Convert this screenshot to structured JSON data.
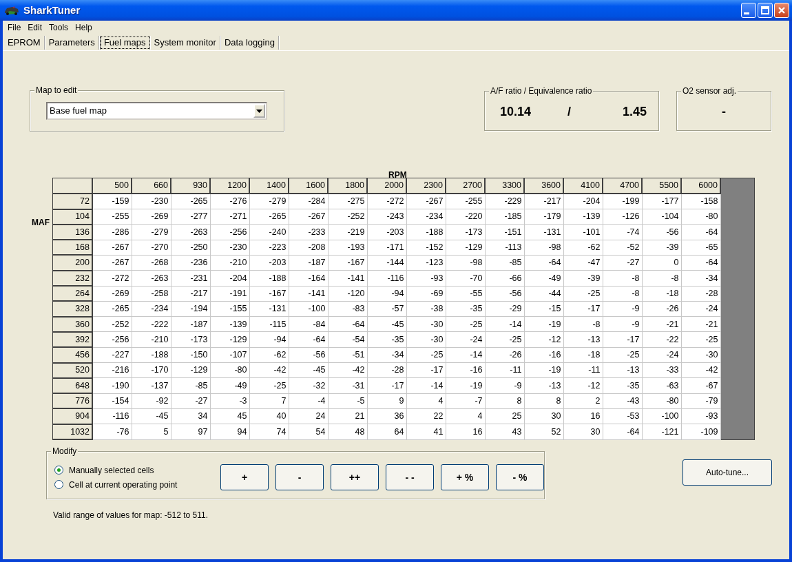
{
  "window": {
    "title": "SharkTuner"
  },
  "menu": [
    "File",
    "Edit",
    "Tools",
    "Help"
  ],
  "tabs": [
    {
      "label": "EPROM",
      "selected": false
    },
    {
      "label": "Parameters",
      "selected": false
    },
    {
      "label": "Fuel maps",
      "selected": true
    },
    {
      "label": "System monitor",
      "selected": false
    },
    {
      "label": "Data logging",
      "selected": false
    }
  ],
  "map_to_edit": {
    "label": "Map to edit",
    "value": "Base fuel map"
  },
  "af_ratio": {
    "label": "A/F ratio / Equivalence ratio",
    "af": "10.14",
    "separator": "/",
    "equivalence": "1.45"
  },
  "o2_sensor": {
    "label": "O2 sensor adj.",
    "value": "-"
  },
  "fuel_table": {
    "x_label": "RPM",
    "y_label": "MAF",
    "columns": [
      "500",
      "660",
      "930",
      "1200",
      "1400",
      "1600",
      "1800",
      "2000",
      "2300",
      "2700",
      "3300",
      "3600",
      "4100",
      "4700",
      "5500",
      "6000"
    ],
    "rows": [
      {
        "label": "72",
        "cells": [
          "-159",
          "-230",
          "-265",
          "-276",
          "-279",
          "-284",
          "-275",
          "-272",
          "-267",
          "-255",
          "-229",
          "-217",
          "-204",
          "-199",
          "-177",
          "-158"
        ]
      },
      {
        "label": "104",
        "cells": [
          "-255",
          "-269",
          "-277",
          "-271",
          "-265",
          "-267",
          "-252",
          "-243",
          "-234",
          "-220",
          "-185",
          "-179",
          "-139",
          "-126",
          "-104",
          "-80"
        ]
      },
      {
        "label": "136",
        "cells": [
          "-286",
          "-279",
          "-263",
          "-256",
          "-240",
          "-233",
          "-219",
          "-203",
          "-188",
          "-173",
          "-151",
          "-131",
          "-101",
          "-74",
          "-56",
          "-64"
        ]
      },
      {
        "label": "168",
        "cells": [
          "-267",
          "-270",
          "-250",
          "-230",
          "-223",
          "-208",
          "-193",
          "-171",
          "-152",
          "-129",
          "-113",
          "-98",
          "-62",
          "-52",
          "-39",
          "-65"
        ]
      },
      {
        "label": "200",
        "cells": [
          "-267",
          "-268",
          "-236",
          "-210",
          "-203",
          "-187",
          "-167",
          "-144",
          "-123",
          "-98",
          "-85",
          "-64",
          "-47",
          "-27",
          "0",
          "-64"
        ]
      },
      {
        "label": "232",
        "cells": [
          "-272",
          "-263",
          "-231",
          "-204",
          "-188",
          "-164",
          "-141",
          "-116",
          "-93",
          "-70",
          "-66",
          "-49",
          "-39",
          "-8",
          "-8",
          "-34"
        ]
      },
      {
        "label": "264",
        "cells": [
          "-269",
          "-258",
          "-217",
          "-191",
          "-167",
          "-141",
          "-120",
          "-94",
          "-69",
          "-55",
          "-56",
          "-44",
          "-25",
          "-8",
          "-18",
          "-28"
        ]
      },
      {
        "label": "328",
        "cells": [
          "-265",
          "-234",
          "-194",
          "-155",
          "-131",
          "-100",
          "-83",
          "-57",
          "-38",
          "-35",
          "-29",
          "-15",
          "-17",
          "-9",
          "-26",
          "-24"
        ]
      },
      {
        "label": "360",
        "cells": [
          "-252",
          "-222",
          "-187",
          "-139",
          "-115",
          "-84",
          "-64",
          "-45",
          "-30",
          "-25",
          "-14",
          "-19",
          "-8",
          "-9",
          "-21",
          "-21"
        ]
      },
      {
        "label": "392",
        "cells": [
          "-256",
          "-210",
          "-173",
          "-129",
          "-94",
          "-64",
          "-54",
          "-35",
          "-30",
          "-24",
          "-25",
          "-12",
          "-13",
          "-17",
          "-22",
          "-25"
        ]
      },
      {
        "label": "456",
        "cells": [
          "-227",
          "-188",
          "-150",
          "-107",
          "-62",
          "-56",
          "-51",
          "-34",
          "-25",
          "-14",
          "-26",
          "-16",
          "-18",
          "-25",
          "-24",
          "-30"
        ]
      },
      {
        "label": "520",
        "cells": [
          "-216",
          "-170",
          "-129",
          "-80",
          "-42",
          "-45",
          "-42",
          "-28",
          "-17",
          "-16",
          "-11",
          "-19",
          "-11",
          "-13",
          "-33",
          "-42"
        ]
      },
      {
        "label": "648",
        "cells": [
          "-190",
          "-137",
          "-85",
          "-49",
          "-25",
          "-32",
          "-31",
          "-17",
          "-14",
          "-19",
          "-9",
          "-13",
          "-12",
          "-35",
          "-63",
          "-67"
        ]
      },
      {
        "label": "776",
        "cells": [
          "-154",
          "-92",
          "-27",
          "-3",
          "7",
          "-4",
          "-5",
          "9",
          "4",
          "-7",
          "8",
          "8",
          "2",
          "-43",
          "-80",
          "-79"
        ]
      },
      {
        "label": "904",
        "cells": [
          "-116",
          "-45",
          "34",
          "45",
          "40",
          "24",
          "21",
          "36",
          "22",
          "4",
          "25",
          "30",
          "16",
          "-53",
          "-100",
          "-93"
        ]
      },
      {
        "label": "1032",
        "cells": [
          "-76",
          "5",
          "97",
          "94",
          "74",
          "54",
          "48",
          "64",
          "41",
          "16",
          "43",
          "52",
          "30",
          "-64",
          "-121",
          "-109"
        ]
      }
    ]
  },
  "modify": {
    "label": "Modify",
    "options": [
      {
        "label": "Manually selected cells",
        "selected": true
      },
      {
        "label": "Cell at current operating point",
        "selected": false
      }
    ],
    "buttons": [
      "+",
      "-",
      "++",
      "- -",
      "+ %",
      "- %"
    ]
  },
  "auto_tune": "Auto-tune...",
  "note": "Valid range of values for map: -512 to 511."
}
